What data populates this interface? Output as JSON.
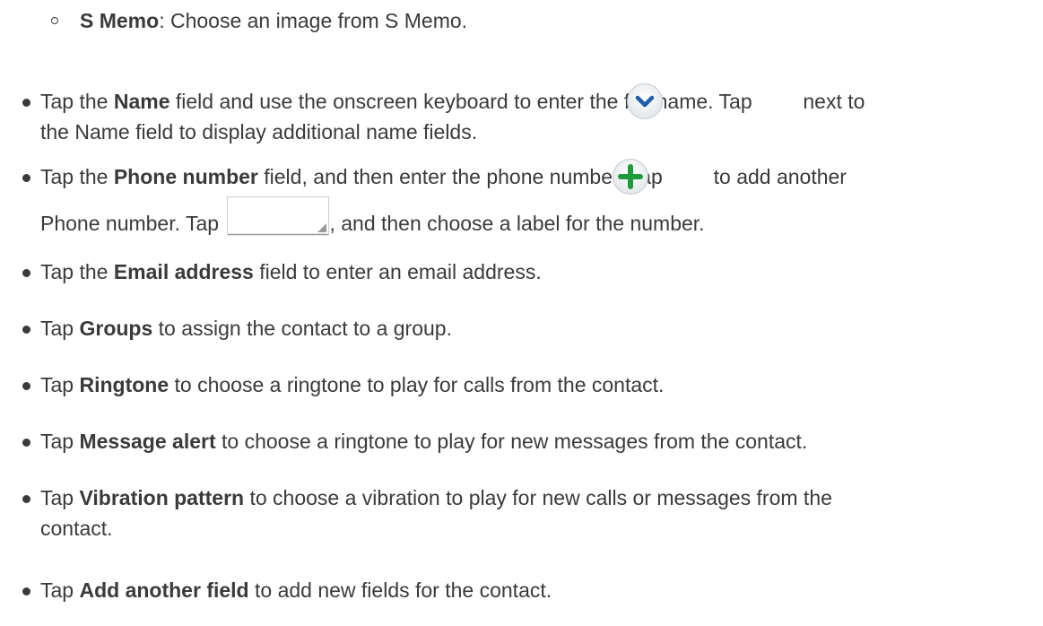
{
  "sub_item": {
    "bold": "S Memo",
    "text": ": Choose an image from S Memo."
  },
  "items": [
    {
      "pre": "Tap the ",
      "bold": "Name",
      "post": " field and use the onscreen keyboard to enter the full name. Tap ",
      "post2": " next to",
      "cont": "the Name field to display additional name fields."
    },
    {
      "pre": "Tap the ",
      "bold": "Phone number",
      "post": " field, and then enter the phone number. Tap ",
      "post2": " to add another",
      "cont_pre": "Phone number. Tap ",
      "cont_post": ", and then choose a label for the number."
    },
    {
      "pre": "Tap the ",
      "bold": "Email address",
      "post": " field to enter an email address."
    },
    {
      "pre": "Tap ",
      "bold": "Groups",
      "post": " to assign the contact to a group."
    },
    {
      "pre": "Tap ",
      "bold": "Ringtone",
      "post": " to choose a ringtone to play for calls from the contact."
    },
    {
      "pre": "Tap ",
      "bold": "Message alert",
      "post": " to choose a ringtone to play for new messages from the contact."
    },
    {
      "pre": "Tap ",
      "bold": "Vibration pattern",
      "post": " to choose a vibration to play for new calls or messages from the",
      "cont": "contact."
    },
    {
      "pre": "Tap ",
      "bold": "Add another field",
      "post": " to add new fields for the contact."
    }
  ],
  "icons": {
    "expand": "chevron-down-icon",
    "add": "plus-icon",
    "label_dropdown": "dropdown-label-icon"
  },
  "colors": {
    "text": "#3a3a3a",
    "plus_green": "#1f9a3c",
    "chevron_blue": "#1e5fa8"
  }
}
